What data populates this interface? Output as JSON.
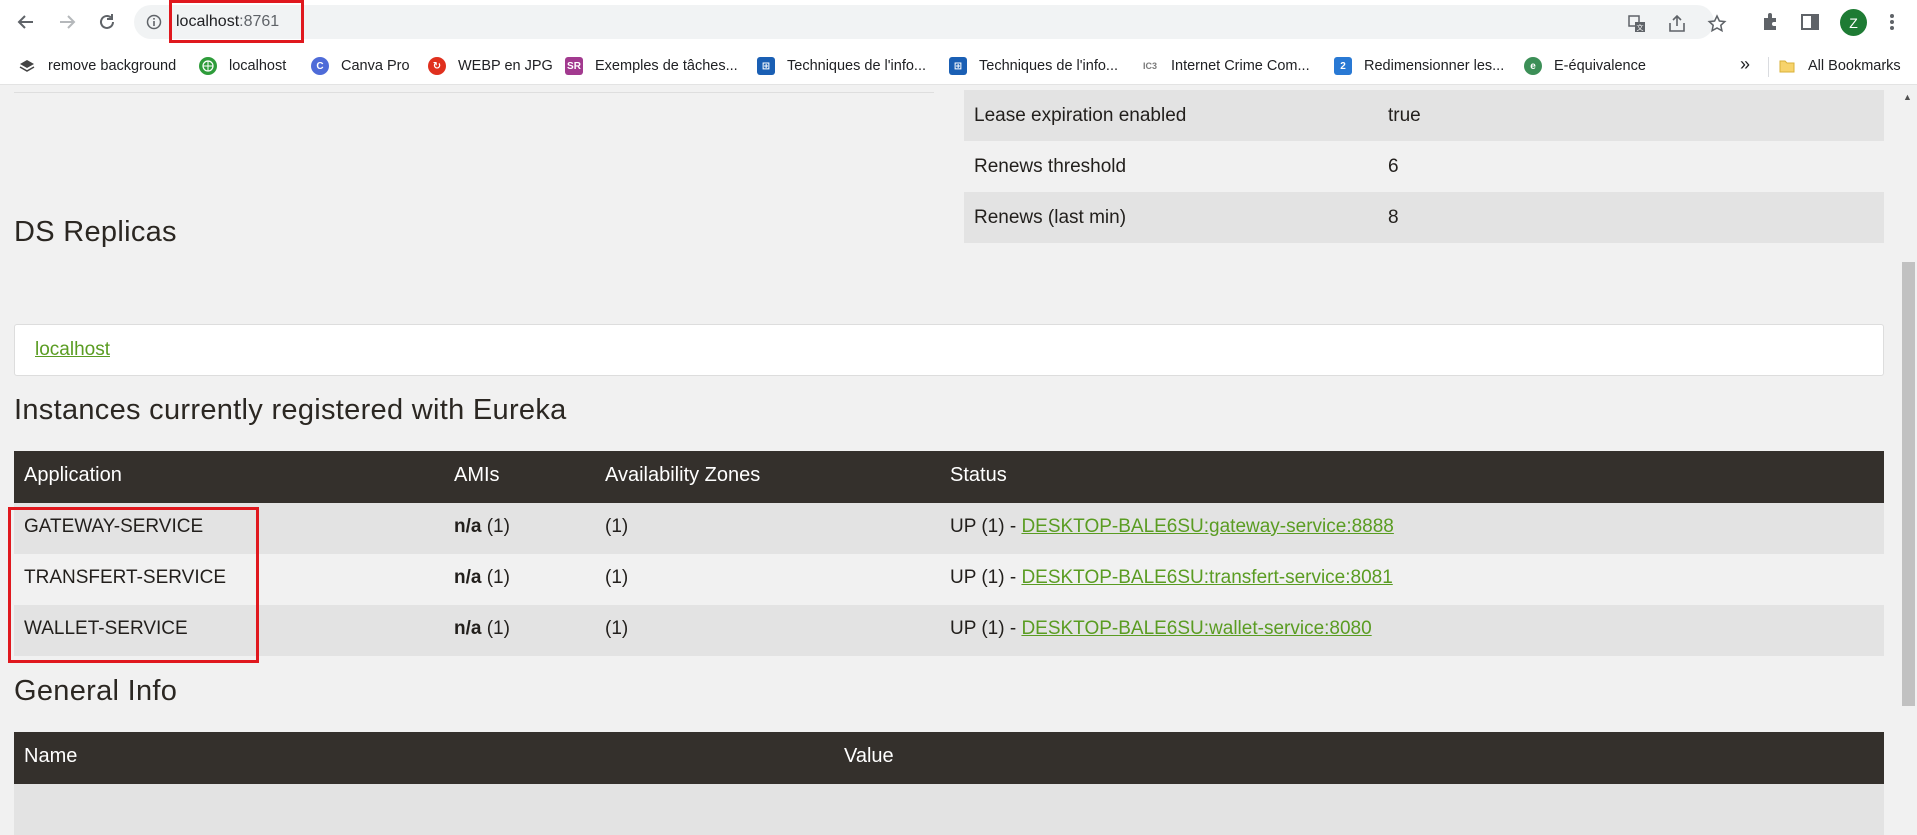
{
  "browser": {
    "url_host": "localhost",
    "url_port": ":8761",
    "bookmarks": [
      {
        "label": "remove background",
        "icon": "layers-icon",
        "color": "#444444"
      },
      {
        "label": "localhost",
        "icon": "globe-icon",
        "color": "#2e9c3a"
      },
      {
        "label": "Canva Pro",
        "icon": "canva-icon",
        "color": "#4e6bd8"
      },
      {
        "label": "WEBP en JPG",
        "icon": "convert-icon",
        "color": "#e0301e"
      },
      {
        "label": "Exemples de tâches...",
        "icon": "sr-icon",
        "color": "#a23a8f"
      },
      {
        "label": "Techniques de l'info...",
        "icon": "college-icon",
        "color": "#1a5fb4"
      },
      {
        "label": "Techniques de l'info...",
        "icon": "college-icon",
        "color": "#1a5fb4"
      },
      {
        "label": "Internet Crime Com...",
        "icon": "ic3-icon",
        "color": "#7a7a7a"
      },
      {
        "label": "Redimensionner les...",
        "icon": "resize-icon",
        "color": "#2979d4"
      },
      {
        "label": "E-équivalence",
        "icon": "globe-icon",
        "color": "#3c8f57"
      }
    ],
    "more_label": "»",
    "all_bookmarks_label": "All Bookmarks",
    "avatar_letter": "Z"
  },
  "status_table": [
    {
      "key": "Lease expiration enabled",
      "value": "true"
    },
    {
      "key": "Renews threshold",
      "value": "6"
    },
    {
      "key": "Renews (last min)",
      "value": "8"
    }
  ],
  "ds_replicas": {
    "heading": "DS Replicas",
    "link": "localhost"
  },
  "instances": {
    "heading": "Instances currently registered with Eureka",
    "columns": [
      "Application",
      "AMIs",
      "Availability Zones",
      "Status"
    ],
    "rows": [
      {
        "application": "GATEWAY-SERVICE",
        "ami_bold": "n/a",
        "ami_count": " (1)",
        "zones": "(1)",
        "status_prefix": "UP (1) - ",
        "status_link": "DESKTOP-BALE6SU:gateway-service:8888"
      },
      {
        "application": "TRANSFERT-SERVICE",
        "ami_bold": "n/a",
        "ami_count": " (1)",
        "zones": "(1)",
        "status_prefix": "UP (1) - ",
        "status_link": "DESKTOP-BALE6SU:transfert-service:8081"
      },
      {
        "application": "WALLET-SERVICE",
        "ami_bold": "n/a",
        "ami_count": " (1)",
        "zones": "(1)",
        "status_prefix": "UP (1) - ",
        "status_link": "DESKTOP-BALE6SU:wallet-service:8080"
      }
    ]
  },
  "general_info": {
    "heading": "General Info",
    "columns": [
      "Name",
      "Value"
    ]
  },
  "colors": {
    "header_dark": "#34302c",
    "link_green": "#5a9c22",
    "highlight_red": "#e0181e"
  }
}
